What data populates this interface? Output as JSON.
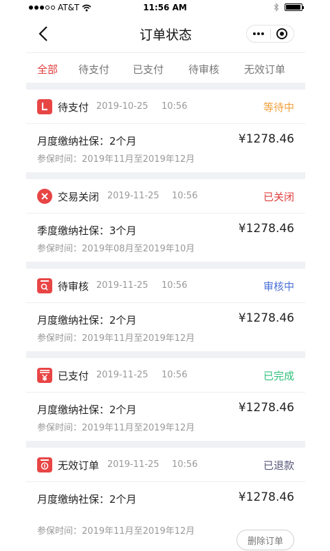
{
  "status_bar": {
    "carrier": "AT&T",
    "time": "11:56 AM"
  },
  "nav": {
    "title": "订单状态"
  },
  "tabs": [
    {
      "label": "全部",
      "active": true
    },
    {
      "label": "待支付",
      "active": false
    },
    {
      "label": "已支付",
      "active": false
    },
    {
      "label": "待审核",
      "active": false
    },
    {
      "label": "无效订单",
      "active": false
    }
  ],
  "orders": [
    {
      "type": "待支付",
      "date": "2019-10-25",
      "time": "10:56",
      "status": "等待中",
      "status_color": "#f0a03c",
      "icon": "pending-payment-icon",
      "description": "月度缴纳社保：2个月",
      "amount": "¥1278.46",
      "period": "参保时间：2019年11月至2019年12月"
    },
    {
      "type": "交易关闭",
      "date": "2019-11-25",
      "time": "10:56",
      "status": "已关闭",
      "status_color": "#e03c3c",
      "icon": "close-circle-icon",
      "description": "季度缴纳社保：3个月",
      "amount": "¥1278.46",
      "period": "参保时间：2019年08月至2019年10月"
    },
    {
      "type": "待审核",
      "date": "2019-11-25",
      "time": "10:56",
      "status": "审核中",
      "status_color": "#4a6fd8",
      "icon": "review-icon",
      "description": "月度缴纳社保：2个月",
      "amount": "¥1278.46",
      "period": "参保时间：2019年11月至2019年12月"
    },
    {
      "type": "已支付",
      "date": "2019-11-25",
      "time": "10:56",
      "status": "已完成",
      "status_color": "#2fbf7a",
      "icon": "paid-yen-icon",
      "description": "月度缴纳社保：2个月",
      "amount": "¥1278.46",
      "period": "参保时间：2019年11月至2019年12月"
    },
    {
      "type": "无效订单",
      "date": "2019-11-25",
      "time": "10:56",
      "status": "已退款",
      "status_color": "#555577",
      "icon": "invalid-order-icon",
      "description": "月度缴纳社保：2个月",
      "amount": "¥1278.46",
      "period": "参保时间：2019年11月至2019年12月",
      "action": "删除订单"
    }
  ],
  "colors": {
    "accent": "#e03c3c",
    "background_gap": "#f0f1f4"
  }
}
